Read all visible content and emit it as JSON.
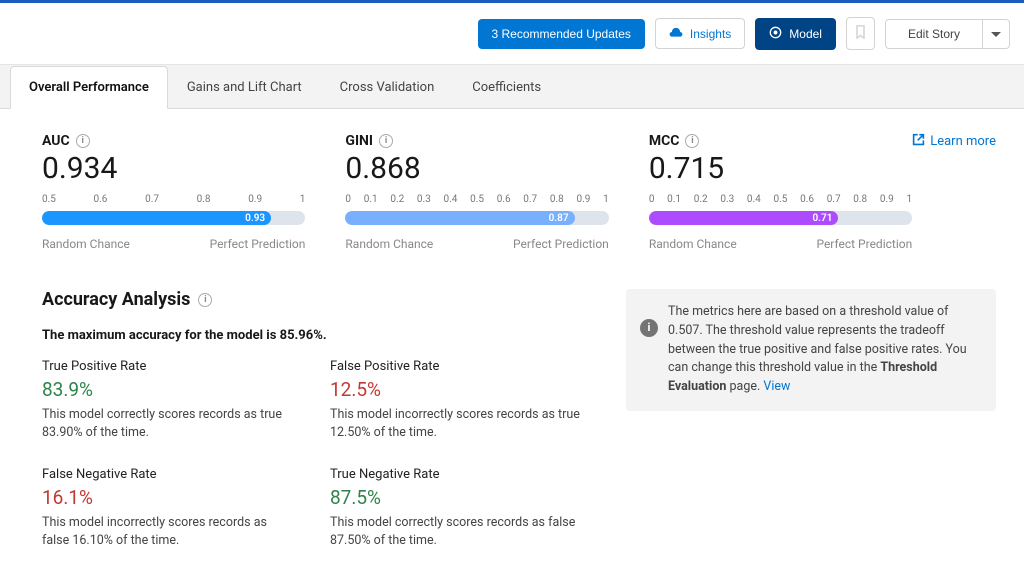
{
  "toolbar": {
    "recommended": "3 Recommended Updates",
    "insights": "Insights",
    "model": "Model",
    "edit": "Edit Story"
  },
  "tabs": [
    "Overall Performance",
    "Gains and Lift Chart",
    "Cross Validation",
    "Coefficients"
  ],
  "learn_more": "Learn more",
  "gauges": [
    {
      "name": "AUC",
      "value": "0.934",
      "ticks": [
        "0.5",
        "0.6",
        "0.7",
        "0.8",
        "0.9",
        "1"
      ],
      "fill": 0.87,
      "badge": "0.93",
      "color": "#1b96ff",
      "left": "Random Chance",
      "right": "Perfect Prediction"
    },
    {
      "name": "GINI",
      "value": "0.868",
      "ticks": [
        "0",
        "0.1",
        "0.2",
        "0.3",
        "0.4",
        "0.5",
        "0.6",
        "0.7",
        "0.8",
        "0.9",
        "1"
      ],
      "fill": 0.87,
      "badge": "0.87",
      "color": "#78b0fd",
      "left": "Random Chance",
      "right": "Perfect Prediction"
    },
    {
      "name": "MCC",
      "value": "0.715",
      "ticks": [
        "0",
        "0.1",
        "0.2",
        "0.3",
        "0.4",
        "0.5",
        "0.6",
        "0.7",
        "0.8",
        "0.9",
        "1"
      ],
      "fill": 0.72,
      "badge": "0.71",
      "color": "#ad4bff",
      "left": "Random Chance",
      "right": "Perfect Prediction"
    }
  ],
  "accuracy": {
    "title": "Accuracy Analysis",
    "subtitle": "The maximum accuracy for the model is 85.96%.",
    "cells": [
      {
        "h": "True Positive Rate",
        "v": "83.9%",
        "cls": "green",
        "d": "This model correctly scores records as true 83.90% of the time."
      },
      {
        "h": "False Positive Rate",
        "v": "12.5%",
        "cls": "red",
        "d": "This model incorrectly scores records as true 12.50% of the time."
      },
      {
        "h": "False Negative Rate",
        "v": "16.1%",
        "cls": "red",
        "d": "This model incorrectly scores records as false 16.10% of the time."
      },
      {
        "h": "True Negative Rate",
        "v": "87.5%",
        "cls": "green",
        "d": "This model correctly scores records as false 87.50% of the time."
      }
    ]
  },
  "infobox": {
    "text_pre": "The metrics here are based on a threshold value of 0.507. The threshold value represents the tradeoff between the true positive and false positive rates. You can change this threshold value in the ",
    "bold": "Threshold Evaluation",
    "text_post": " page. ",
    "link": "View"
  },
  "chart_data": [
    {
      "type": "gauge",
      "title": "AUC",
      "value": 0.934,
      "display": 0.93,
      "domain": [
        0.5,
        1
      ]
    },
    {
      "type": "gauge",
      "title": "GINI",
      "value": 0.868,
      "display": 0.87,
      "domain": [
        0,
        1
      ]
    },
    {
      "type": "gauge",
      "title": "MCC",
      "value": 0.715,
      "display": 0.71,
      "domain": [
        0,
        1
      ]
    }
  ]
}
